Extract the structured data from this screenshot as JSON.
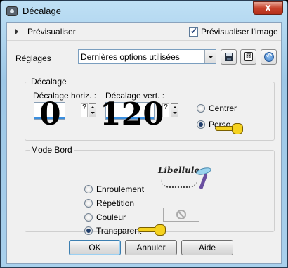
{
  "window": {
    "title": "Décalage",
    "close_glyph": "X"
  },
  "preview": {
    "label": "Prévisualiser",
    "preview_image_label": "Prévisualiser l'image",
    "preview_image_checked": true
  },
  "settings": {
    "label": "Réglages",
    "preset_value": "Dernières options utilisées"
  },
  "offset": {
    "group_title": "Décalage",
    "horizontal_label": "Décalage horiz. :",
    "horizontal_value": "0",
    "vertical_label": "Décalage vert. :",
    "vertical_value": "120",
    "help_glyph": "?",
    "options": [
      {
        "label": "Centrer",
        "selected": false
      },
      {
        "label": "Perso",
        "selected": true
      }
    ]
  },
  "edge_mode": {
    "group_title": "Mode Bord",
    "options": [
      {
        "label": "Enroulement",
        "selected": false
      },
      {
        "label": "Répétition",
        "selected": false
      },
      {
        "label": "Couleur",
        "selected": false
      },
      {
        "label": "Transparent",
        "selected": true
      }
    ]
  },
  "watermark": {
    "text": "Libellule"
  },
  "buttons": {
    "ok": "OK",
    "cancel": "Annuler",
    "help": "Aide"
  },
  "colors": {
    "pointer_hand": "#f5d21f",
    "title_gradient": "#a9d0ec",
    "close_button": "#c7422c"
  },
  "icons": [
    "app-icon",
    "save-icon",
    "dice-icon",
    "reset-icon",
    "no-color-icon",
    "pointer-hand-icon"
  ]
}
